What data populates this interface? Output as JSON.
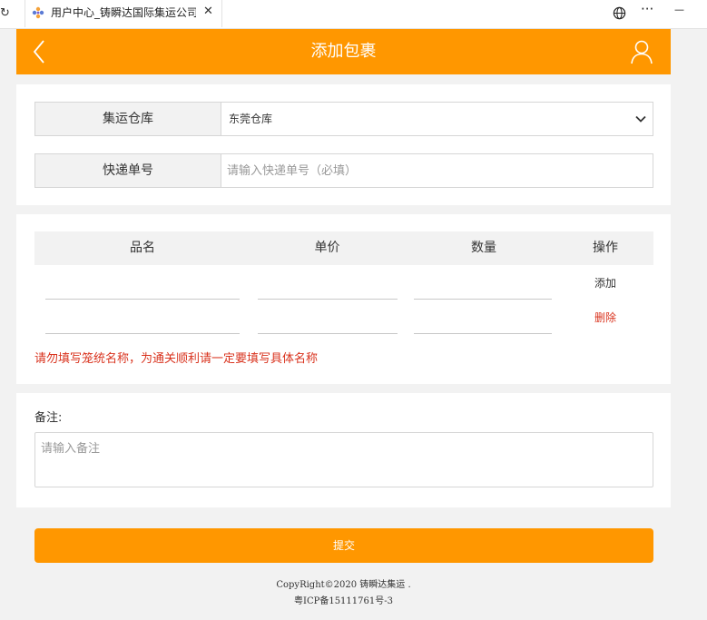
{
  "browser": {
    "tab_title": "用户中心_铸瞬达国际集运公司",
    "reload_glyph": "↻",
    "close_glyph": "✕",
    "menu_glyph": "···",
    "minimize_glyph": "—"
  },
  "header": {
    "title": "添加包裹"
  },
  "warehouse": {
    "label": "集运仓库",
    "selected": "东莞仓库"
  },
  "tracking": {
    "label": "快递单号",
    "placeholder": "请输入快递单号（必填）"
  },
  "goods": {
    "columns": [
      "品名",
      "单价",
      "数量",
      "操作"
    ],
    "add_label": "添加",
    "delete_label": "删除",
    "warning": "请勿填写笼统名称，为通关顺利请一定要填写具体名称"
  },
  "remarks": {
    "label": "备注:",
    "placeholder": "请输入备注"
  },
  "submit": {
    "label": "提交"
  },
  "footer": {
    "copyright": "CopyRight©2020 铸瞬达集运 .",
    "icp": "粤ICP备15111761号-3"
  },
  "colors": {
    "accent": "#ff9700",
    "warning": "#d9331e"
  }
}
